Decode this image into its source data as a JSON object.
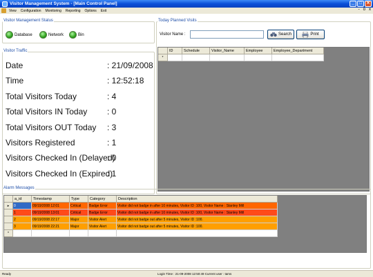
{
  "window": {
    "title": "Visitor Management System - [Main Control Panel]",
    "min": "_",
    "max": "□",
    "close": "✕"
  },
  "menu": {
    "items": [
      "View",
      "Configuration",
      "Monitoring",
      "Reporting",
      "Options",
      "Exit"
    ],
    "mdi_min": "-",
    "mdi_max": "ö",
    "mdi_close": "x"
  },
  "status_panel": {
    "title": "Visitor Management Status",
    "items": [
      {
        "label": "Database",
        "status_color": "#2fa31d"
      },
      {
        "label": "Network",
        "status_color": "#2fa31d"
      },
      {
        "label": "Bin",
        "status_color": "#2fa31d"
      }
    ]
  },
  "traffic": {
    "title": "Visitor Traffic",
    "rows": [
      {
        "label": "Date",
        "value": ": 21/09/2008"
      },
      {
        "label": "Time",
        "value": ": 12:52:18"
      },
      {
        "label": "Total Visitors Today",
        "value": ": 4"
      },
      {
        "label": "Total Visitors IN Today",
        "value": ": 0"
      },
      {
        "label": "Total Visitors OUT Today",
        "value": ": 3"
      },
      {
        "label": "Visitors Registered",
        "value": ": 1"
      },
      {
        "label": "Visitors Checked In (Delayed)",
        "value": ": 0"
      },
      {
        "label": "Visitors Checked In (Expired)",
        "value": ": 1"
      }
    ]
  },
  "planned": {
    "title": "Today Planned Visits",
    "visitor_name_label": "Visitor Name :",
    "visitor_name_value": "",
    "search_label": "Search",
    "print_label": "Print",
    "columns": [
      "ID",
      "Schedule",
      "Visitor_Name",
      "Employee",
      "Employee_Department"
    ],
    "new_row_marker": "*"
  },
  "alarms": {
    "title": "Alarm Messages",
    "columns": [
      "a_id",
      "Timestamp",
      "Type",
      "Category",
      "Description"
    ],
    "rows": [
      {
        "marker": "▸",
        "a_id": "0",
        "timestamp": "09/19/2008 12:01",
        "type": "Critical",
        "category": "Badge Error",
        "description": "Visitor did not badge in after 10 minutes, Visitor ID :100, Visitor Name : Stanley Mill",
        "bg": "#ff6600"
      },
      {
        "marker": "",
        "a_id": "1",
        "timestamp": "09/19/2008 13:01",
        "type": "Critical",
        "category": "Badge Error",
        "description": "Visitor did not badge in after 10 minutes, Visitor ID :100, Visitor Name : Stanley Mill",
        "bg": "#ff4a1a"
      },
      {
        "marker": "",
        "a_id": "2",
        "timestamp": "09/19/2008 22:17",
        "type": "Major",
        "category": "Visitor Alert",
        "description": "Visitor did not badge out after 5 minutes, Visitor ID :100.",
        "bg": "#ff9f00"
      },
      {
        "marker": "",
        "a_id": "3",
        "timestamp": "09/19/2008 22:21",
        "type": "Major",
        "category": "Visitor Alert",
        "description": "Visitor did not badge out after 5 minutes, Visitor ID :100.",
        "bg": "#ff9f00"
      }
    ],
    "new_row_marker": "*"
  },
  "statusbar": {
    "left": "Ready",
    "center": "Login Time : 21-09-2008 12:50:49  Current user : tams"
  }
}
